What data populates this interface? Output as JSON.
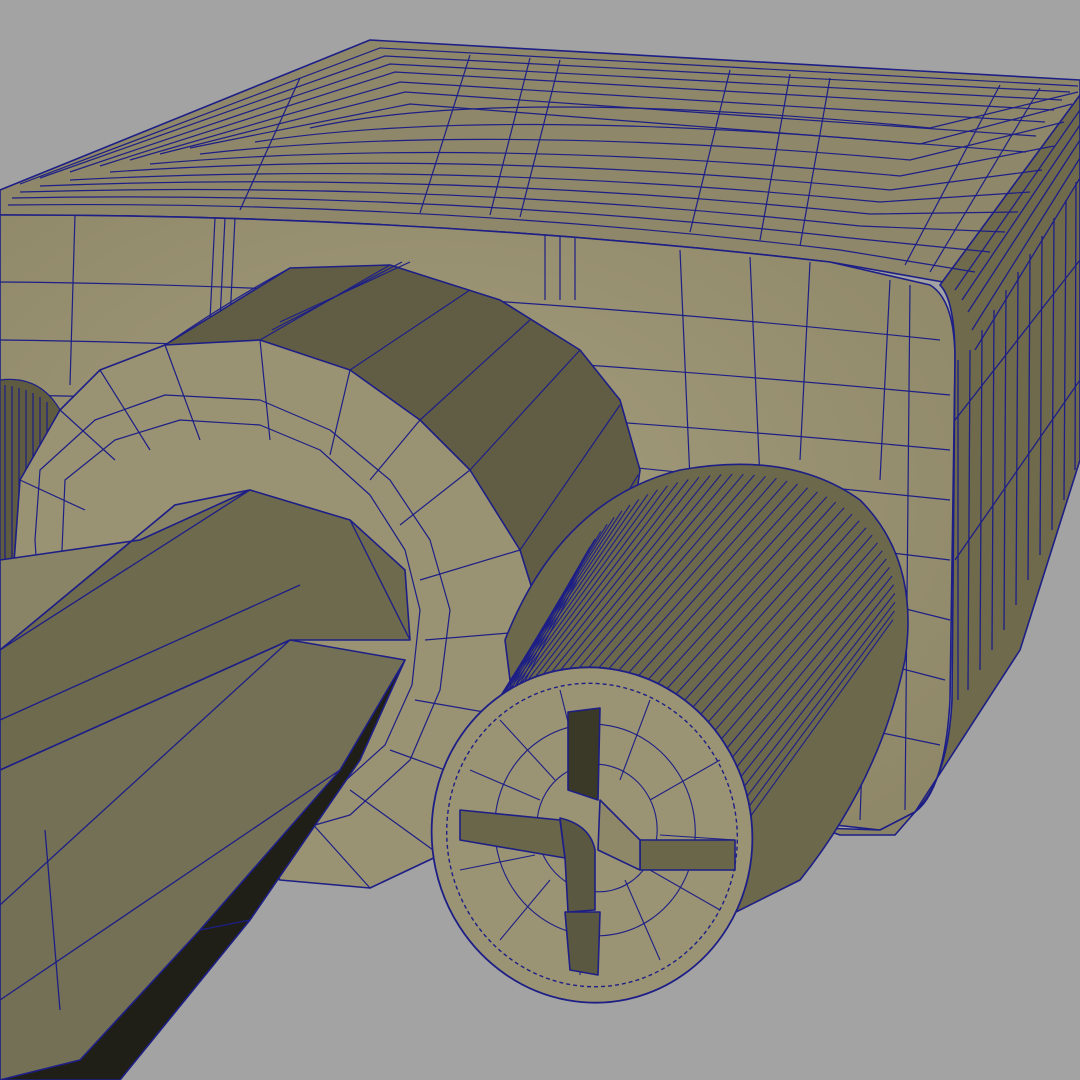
{
  "viewport": {
    "background": "#a3a3a3",
    "shaded_mode": "wireframe-on-shaded",
    "colors": {
      "surface_light": "#9b9474",
      "surface_mid": "#77704f",
      "surface_dark": "#5c5940",
      "surface_shadow": "#1f1f18",
      "wire": "#1d1f86"
    },
    "objects": [
      {
        "name": "connector-housing"
      },
      {
        "name": "large-flange"
      },
      {
        "name": "hex-shaft"
      },
      {
        "name": "knurled-knob"
      },
      {
        "name": "left-partial-knob"
      }
    ]
  }
}
